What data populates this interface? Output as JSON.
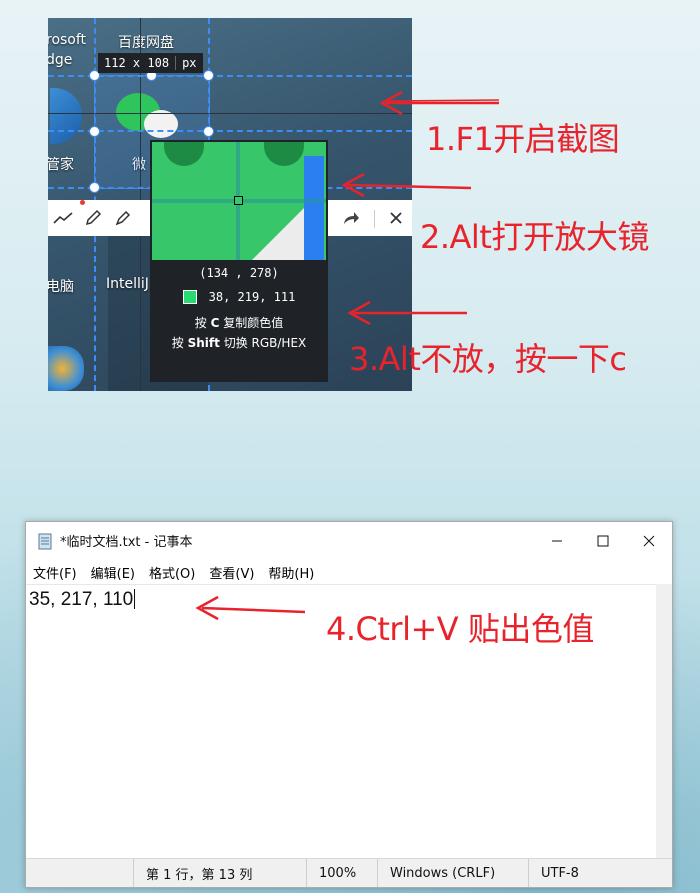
{
  "screenshot": {
    "desktop_labels": [
      "rosoft",
      "dge",
      "百度网盘",
      "管家",
      "微",
      "电脑",
      "IntelliJ IDEA"
    ],
    "size_badge": {
      "width": "112",
      "x": "x",
      "height": "108",
      "unit": "px"
    },
    "magnifier": {
      "coord": "(134 , 278)",
      "rgb": "38, 219, 111",
      "swatch_color": "#26db6f",
      "hint1_prefix": "按",
      "hint1_key": "C",
      "hint1_suffix": "复制颜色值",
      "hint2_prefix": "按",
      "hint2_key": "Shift",
      "hint2_suffix": "切换 RGB/HEX"
    },
    "toolbar_icons": [
      "line-chart-icon",
      "pencil-icon",
      "marker-icon",
      "redo-icon",
      "close-icon"
    ]
  },
  "annotations": {
    "step1": "1.F1开启截图",
    "step2": "2.Alt打开放大镜",
    "step3": "3.Alt不放，按一下c",
    "step4": "4.Ctrl+V 贴出色值"
  },
  "notepad": {
    "title": "*临时文档.txt - 记事本",
    "menu": [
      "文件(F)",
      "编辑(E)",
      "格式(O)",
      "查看(V)",
      "帮助(H)"
    ],
    "content": "35, 217, 110",
    "status": {
      "position": "第 1 行，第 13 列",
      "zoom": "100%",
      "line_ending": "Windows (CRLF)",
      "encoding": "UTF-8"
    }
  },
  "colors": {
    "accent_blue": "#3d8df5",
    "annotation_red": "#e8232b"
  }
}
